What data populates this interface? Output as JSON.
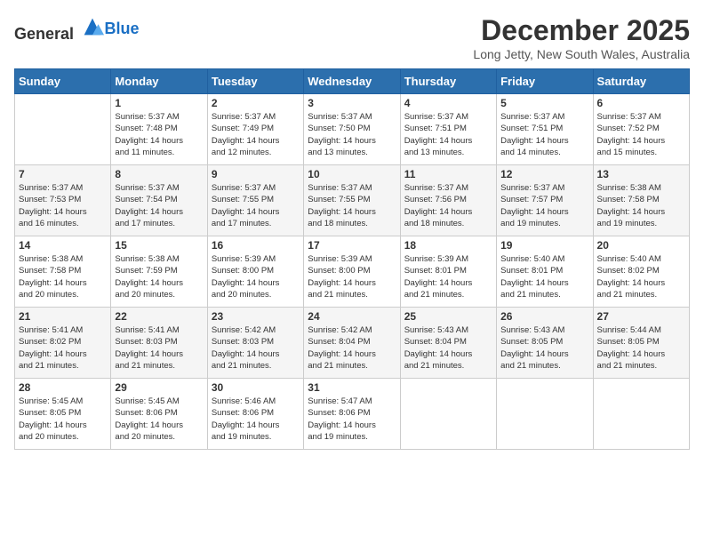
{
  "logo": {
    "general": "General",
    "blue": "Blue"
  },
  "title": "December 2025",
  "location": "Long Jetty, New South Wales, Australia",
  "days_of_week": [
    "Sunday",
    "Monday",
    "Tuesday",
    "Wednesday",
    "Thursday",
    "Friday",
    "Saturday"
  ],
  "weeks": [
    [
      {
        "day": "",
        "info": ""
      },
      {
        "day": "1",
        "info": "Sunrise: 5:37 AM\nSunset: 7:48 PM\nDaylight: 14 hours\nand 11 minutes."
      },
      {
        "day": "2",
        "info": "Sunrise: 5:37 AM\nSunset: 7:49 PM\nDaylight: 14 hours\nand 12 minutes."
      },
      {
        "day": "3",
        "info": "Sunrise: 5:37 AM\nSunset: 7:50 PM\nDaylight: 14 hours\nand 13 minutes."
      },
      {
        "day": "4",
        "info": "Sunrise: 5:37 AM\nSunset: 7:51 PM\nDaylight: 14 hours\nand 13 minutes."
      },
      {
        "day": "5",
        "info": "Sunrise: 5:37 AM\nSunset: 7:51 PM\nDaylight: 14 hours\nand 14 minutes."
      },
      {
        "day": "6",
        "info": "Sunrise: 5:37 AM\nSunset: 7:52 PM\nDaylight: 14 hours\nand 15 minutes."
      }
    ],
    [
      {
        "day": "7",
        "info": "Sunrise: 5:37 AM\nSunset: 7:53 PM\nDaylight: 14 hours\nand 16 minutes."
      },
      {
        "day": "8",
        "info": "Sunrise: 5:37 AM\nSunset: 7:54 PM\nDaylight: 14 hours\nand 17 minutes."
      },
      {
        "day": "9",
        "info": "Sunrise: 5:37 AM\nSunset: 7:55 PM\nDaylight: 14 hours\nand 17 minutes."
      },
      {
        "day": "10",
        "info": "Sunrise: 5:37 AM\nSunset: 7:55 PM\nDaylight: 14 hours\nand 18 minutes."
      },
      {
        "day": "11",
        "info": "Sunrise: 5:37 AM\nSunset: 7:56 PM\nDaylight: 14 hours\nand 18 minutes."
      },
      {
        "day": "12",
        "info": "Sunrise: 5:37 AM\nSunset: 7:57 PM\nDaylight: 14 hours\nand 19 minutes."
      },
      {
        "day": "13",
        "info": "Sunrise: 5:38 AM\nSunset: 7:58 PM\nDaylight: 14 hours\nand 19 minutes."
      }
    ],
    [
      {
        "day": "14",
        "info": "Sunrise: 5:38 AM\nSunset: 7:58 PM\nDaylight: 14 hours\nand 20 minutes."
      },
      {
        "day": "15",
        "info": "Sunrise: 5:38 AM\nSunset: 7:59 PM\nDaylight: 14 hours\nand 20 minutes."
      },
      {
        "day": "16",
        "info": "Sunrise: 5:39 AM\nSunset: 8:00 PM\nDaylight: 14 hours\nand 20 minutes."
      },
      {
        "day": "17",
        "info": "Sunrise: 5:39 AM\nSunset: 8:00 PM\nDaylight: 14 hours\nand 21 minutes."
      },
      {
        "day": "18",
        "info": "Sunrise: 5:39 AM\nSunset: 8:01 PM\nDaylight: 14 hours\nand 21 minutes."
      },
      {
        "day": "19",
        "info": "Sunrise: 5:40 AM\nSunset: 8:01 PM\nDaylight: 14 hours\nand 21 minutes."
      },
      {
        "day": "20",
        "info": "Sunrise: 5:40 AM\nSunset: 8:02 PM\nDaylight: 14 hours\nand 21 minutes."
      }
    ],
    [
      {
        "day": "21",
        "info": "Sunrise: 5:41 AM\nSunset: 8:02 PM\nDaylight: 14 hours\nand 21 minutes."
      },
      {
        "day": "22",
        "info": "Sunrise: 5:41 AM\nSunset: 8:03 PM\nDaylight: 14 hours\nand 21 minutes."
      },
      {
        "day": "23",
        "info": "Sunrise: 5:42 AM\nSunset: 8:03 PM\nDaylight: 14 hours\nand 21 minutes."
      },
      {
        "day": "24",
        "info": "Sunrise: 5:42 AM\nSunset: 8:04 PM\nDaylight: 14 hours\nand 21 minutes."
      },
      {
        "day": "25",
        "info": "Sunrise: 5:43 AM\nSunset: 8:04 PM\nDaylight: 14 hours\nand 21 minutes."
      },
      {
        "day": "26",
        "info": "Sunrise: 5:43 AM\nSunset: 8:05 PM\nDaylight: 14 hours\nand 21 minutes."
      },
      {
        "day": "27",
        "info": "Sunrise: 5:44 AM\nSunset: 8:05 PM\nDaylight: 14 hours\nand 21 minutes."
      }
    ],
    [
      {
        "day": "28",
        "info": "Sunrise: 5:45 AM\nSunset: 8:05 PM\nDaylight: 14 hours\nand 20 minutes."
      },
      {
        "day": "29",
        "info": "Sunrise: 5:45 AM\nSunset: 8:06 PM\nDaylight: 14 hours\nand 20 minutes."
      },
      {
        "day": "30",
        "info": "Sunrise: 5:46 AM\nSunset: 8:06 PM\nDaylight: 14 hours\nand 19 minutes."
      },
      {
        "day": "31",
        "info": "Sunrise: 5:47 AM\nSunset: 8:06 PM\nDaylight: 14 hours\nand 19 minutes."
      },
      {
        "day": "",
        "info": ""
      },
      {
        "day": "",
        "info": ""
      },
      {
        "day": "",
        "info": ""
      }
    ]
  ]
}
